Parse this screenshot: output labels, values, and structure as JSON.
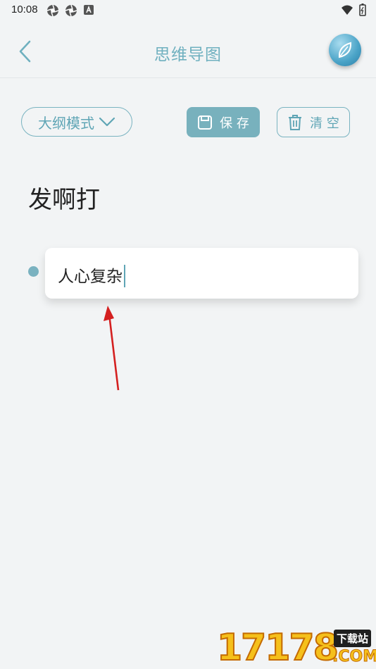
{
  "status_bar": {
    "time": "10:08"
  },
  "app_bar": {
    "title": "思维导图"
  },
  "toolbar": {
    "mode_label": "大纲模式",
    "save_label": "保 存",
    "clear_label": "清 空"
  },
  "map": {
    "title": "发啊打",
    "nodes": [
      {
        "text": "人心复杂"
      }
    ]
  },
  "watermark": {
    "digits": "17178",
    "label": "下载站",
    "suffix": ".COM"
  },
  "colors": {
    "accent": "#78b1bd",
    "background": "#f2f4f5",
    "annotation_arrow": "#d42020"
  }
}
